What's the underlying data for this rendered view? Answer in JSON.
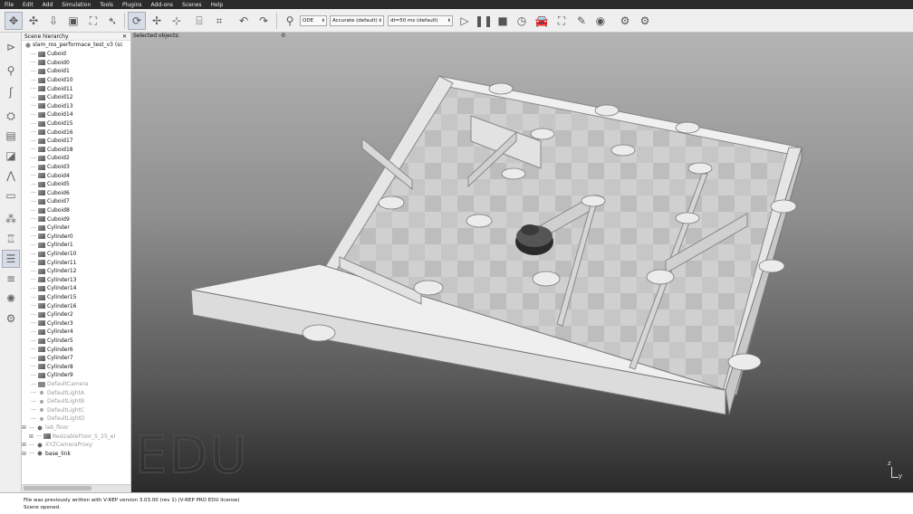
{
  "menu": [
    "File",
    "Edit",
    "Add",
    "Simulation",
    "Tools",
    "Plugins",
    "Add-ons",
    "Scenes",
    "Help"
  ],
  "toolbar": {
    "engine": "ODE",
    "accuracy": "Accurate (default)",
    "timestep": "dt=50 ms (default)"
  },
  "hierarchy": {
    "title": "Scene hierarchy",
    "close": "✕",
    "root": "slam_ros_performace_test_v3 (sc",
    "items": [
      {
        "label": "Cuboid",
        "kind": "shape"
      },
      {
        "label": "Cuboid0",
        "kind": "shape"
      },
      {
        "label": "Cuboid1",
        "kind": "shape"
      },
      {
        "label": "Cuboid10",
        "kind": "shape"
      },
      {
        "label": "Cuboid11",
        "kind": "shape"
      },
      {
        "label": "Cuboid12",
        "kind": "shape"
      },
      {
        "label": "Cuboid13",
        "kind": "shape"
      },
      {
        "label": "Cuboid14",
        "kind": "shape"
      },
      {
        "label": "Cuboid15",
        "kind": "shape"
      },
      {
        "label": "Cuboid16",
        "kind": "shape"
      },
      {
        "label": "Cuboid17",
        "kind": "shape"
      },
      {
        "label": "Cuboid18",
        "kind": "shape"
      },
      {
        "label": "Cuboid2",
        "kind": "shape"
      },
      {
        "label": "Cuboid3",
        "kind": "shape"
      },
      {
        "label": "Cuboid4",
        "kind": "shape"
      },
      {
        "label": "Cuboid5",
        "kind": "shape"
      },
      {
        "label": "Cuboid6",
        "kind": "shape"
      },
      {
        "label": "Cuboid7",
        "kind": "shape"
      },
      {
        "label": "Cuboid8",
        "kind": "shape"
      },
      {
        "label": "Cuboid9",
        "kind": "shape"
      },
      {
        "label": "Cylinder",
        "kind": "shape"
      },
      {
        "label": "Cylinder0",
        "kind": "shape"
      },
      {
        "label": "Cylinder1",
        "kind": "shape"
      },
      {
        "label": "Cylinder10",
        "kind": "shape"
      },
      {
        "label": "Cylinder11",
        "kind": "shape"
      },
      {
        "label": "Cylinder12",
        "kind": "shape"
      },
      {
        "label": "Cylinder13",
        "kind": "shape"
      },
      {
        "label": "Cylinder14",
        "kind": "shape"
      },
      {
        "label": "Cylinder15",
        "kind": "shape"
      },
      {
        "label": "Cylinder16",
        "kind": "shape"
      },
      {
        "label": "Cylinder2",
        "kind": "shape"
      },
      {
        "label": "Cylinder3",
        "kind": "shape"
      },
      {
        "label": "Cylinder4",
        "kind": "shape"
      },
      {
        "label": "Cylinder5",
        "kind": "shape"
      },
      {
        "label": "Cylinder6",
        "kind": "shape"
      },
      {
        "label": "Cylinder7",
        "kind": "shape"
      },
      {
        "label": "Cylinder8",
        "kind": "shape"
      },
      {
        "label": "Cylinder9",
        "kind": "shape"
      },
      {
        "label": "DefaultCamera",
        "kind": "camera",
        "dim": true
      },
      {
        "label": "DefaultLightA",
        "kind": "light",
        "dim": true
      },
      {
        "label": "DefaultLightB",
        "kind": "light",
        "dim": true
      },
      {
        "label": "DefaultLightC",
        "kind": "light",
        "dim": true
      },
      {
        "label": "DefaultLightD",
        "kind": "light",
        "dim": true
      },
      {
        "label": "lab_floor",
        "kind": "group",
        "dim": true,
        "expander": "⊞"
      },
      {
        "label": "ResizableFloor_5_25_el",
        "kind": "shape",
        "dim": true,
        "expander": "⊞",
        "indent": 1
      },
      {
        "label": "XYZCameraProxy",
        "kind": "group",
        "dim": true,
        "expander": "⊞"
      },
      {
        "label": "base_link",
        "kind": "group",
        "dim": false,
        "expander": "⊞"
      }
    ]
  },
  "viewport": {
    "selected_label": "Selected objects:",
    "selected_count": "0",
    "watermark": "EDU",
    "axis_z": "z",
    "axis_y": "y"
  },
  "status": {
    "line1": "File was previously written with V-REP version 3.03.00 (rev 1) (V-REP PRO EDU license)",
    "line2": "Scene opened."
  },
  "icons": {
    "top": [
      "move-icon",
      "rotate-icon",
      "shift-icon",
      "camera-icon",
      "fit-view-icon",
      "path-icon",
      "object-rotate-icon",
      "object-shift-icon",
      "assemble-icon",
      "transfer-dna-icon",
      "undo-icon",
      "redo-icon",
      "search-icon",
      "play-icon",
      "pause-icon",
      "stop-icon",
      "clock-icon",
      "car-icon",
      "dynamics-icon",
      "feather-icon",
      "eye-icon",
      "settings-icon",
      "layers-icon"
    ],
    "left": [
      "views-icon",
      "zoom-icon",
      "calc-icon",
      "scripts-icon",
      "selection-icon",
      "environment-icon",
      "path-planning-icon",
      "collections-icon",
      "model-browser-icon",
      "hierarchy-icon",
      "layers-icon",
      "user-settings-icon",
      "pages-icon"
    ]
  },
  "colors": {
    "active_button": "#d6dde6",
    "menubar": "#2b2b2b"
  }
}
